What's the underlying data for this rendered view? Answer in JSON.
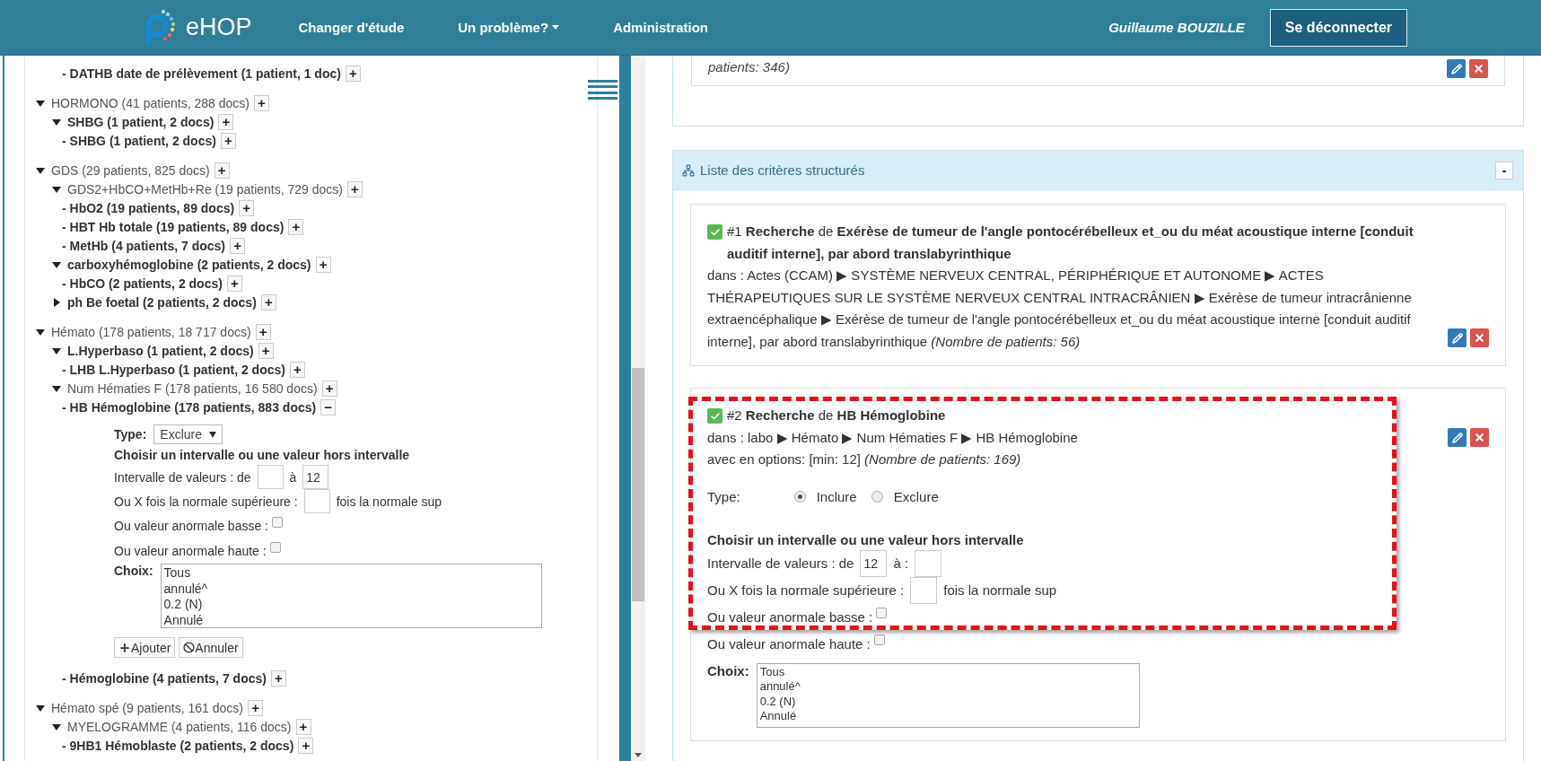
{
  "header": {
    "logo_text": "eHOP",
    "nav": [
      {
        "label": "Changer d'étude",
        "dropdown": false
      },
      {
        "label": "Un problème?",
        "dropdown": true
      },
      {
        "label": "Administration",
        "dropdown": false
      }
    ],
    "user": "Guillaume BOUZILLE",
    "logout": "Se déconnecter"
  },
  "tree": [
    {
      "children": [
        {
          "children": [
            {
              "label": "- DATHB date de prélèvement (1 patient, 1 doc)",
              "bold": true,
              "action": "+"
            }
          ]
        }
      ]
    },
    {
      "label": "HORMONO (41 patients, 288 docs)",
      "bold": false,
      "expanded": true,
      "action": "+",
      "children": [
        {
          "label": "SHBG (1 patient, 2 docs)",
          "bold": true,
          "expanded": true,
          "action": "+",
          "children": [
            {
              "label": "- SHBG (1 patient, 2 docs)",
              "bold": true,
              "action": "+"
            }
          ]
        }
      ]
    },
    {
      "label": "GDS (29 patients, 825 docs)",
      "bold": false,
      "expanded": true,
      "action": "+",
      "children": [
        {
          "label": "GDS2+HbCO+MetHb+Re (19 patients, 729 docs)",
          "bold": false,
          "expanded": true,
          "action": "+",
          "children": [
            {
              "label": "- HbO2 (19 patients, 89 docs)",
              "bold": true,
              "action": "+"
            },
            {
              "label": "- HBT Hb totale (19 patients, 89 docs)",
              "bold": true,
              "action": "+"
            },
            {
              "label": "- MetHb (4 patients, 7 docs)",
              "bold": true,
              "action": "+"
            }
          ]
        },
        {
          "label": "carboxyhémoglobine (2 patients, 2 docs)",
          "bold": true,
          "expanded": true,
          "action": "+",
          "children": [
            {
              "label": "- HbCO (2 patients, 2 docs)",
              "bold": true,
              "action": "+"
            }
          ]
        },
        {
          "label": "ph Be foetal (2 patients, 2 docs)",
          "bold": true,
          "expanded": false,
          "action": "+"
        }
      ]
    },
    {
      "label": "Hémato (178 patients, 18 717 docs)",
      "bold": false,
      "expanded": true,
      "action": "+",
      "children": [
        {
          "label": "L.Hyperbaso (1 patient, 2 docs)",
          "bold": true,
          "expanded": true,
          "action": "+",
          "children": [
            {
              "label": "- LHB L.Hyperbaso (1 patient, 2 docs)",
              "bold": true,
              "action": "+"
            }
          ]
        },
        {
          "label": "Num Hématies F (178 patients, 16 580 docs)",
          "bold": false,
          "expanded": true,
          "action": "+",
          "children": [
            {
              "label": "- HB Hémoglobine (178 patients, 883 docs)",
              "bold": true,
              "action": "−",
              "form": {
                "type_label": "Type:",
                "type_control": {
                  "kind": "select",
                  "value": "Exclure"
                },
                "heading": "Choisir un intervalle ou une valeur hors intervalle",
                "range": {
                  "label": "Intervalle de valeurs : de",
                  "separator": "à",
                  "max": "12"
                },
                "factor": {
                  "label": "Ou X fois la normale supérieure :",
                  "suffix": "fois la normale sup"
                },
                "flags": [
                  {
                    "label": "Ou valeur anormale basse :",
                    "checked": false
                  },
                  {
                    "label": "Ou valeur anormale haute :",
                    "checked": false
                  }
                ],
                "choice": {
                  "label": "Choix:",
                  "options": [
                    "Tous",
                    "annulé^",
                    "0.2 (N)",
                    "Annulé"
                  ]
                },
                "buttons": [
                  {
                    "label": "Ajouter",
                    "kind": "add"
                  },
                  {
                    "label": "Annuler",
                    "kind": "cancel"
                  }
                ]
              }
            },
            {
              "label": "- Hémoglobine (4 patients, 7 docs)",
              "bold": true,
              "action": "+"
            }
          ]
        }
      ]
    },
    {
      "label": "Hémato spé (9 patients, 161 docs)",
      "bold": false,
      "expanded": true,
      "action": "+",
      "children": [
        {
          "label": "MYELOGRAMME (4 patients, 116 docs)",
          "bold": false,
          "expanded": true,
          "action": "+",
          "children": [
            {
              "label": "- 9HB1 Hémoblaste (2 patients, 2 docs)",
              "bold": true,
              "action": "+"
            }
          ]
        }
      ]
    }
  ],
  "previous_card": {
    "count": "patients: 346)"
  },
  "criteria_panel": {
    "title": "Liste des critères structurés",
    "toggle": "-",
    "criteria": [
      {
        "heading": "#1 **Recherche** de **Exérèse de tumeur de l'angle pontocérébelleux et_ou du méat acoustique interne [conduit auditif interne], par abord translabyrinthique**",
        "path": "dans : Actes (CCAM) ▶ SYSTÈME NERVEUX CENTRAL, PÉRIPHÉRIQUE ET AUTONOME ▶ ACTES THÉRAPEUTIQUES SUR LE SYSTÈME NERVEUX CENTRAL INTRACRÂNIEN ▶ Exérèse de tumeur intracrânienne extraencéphalique ▶ Exérèse de tumeur de l'angle pontocérébelleux et_ou du méat acoustique interne [conduit auditif interne], par abord translabyrinthique *(Nombre de patients: 56)*",
        "highlighted": false
      },
      {
        "heading": "#2 **Recherche** de **HB Hémoglobine**",
        "path": "dans : labo ▶ Hémato ▶ Num Hématies F ▶ HB Hémoglobine",
        "options": "avec en options: [min: 12] *(Nombre de patients: 169)*",
        "highlighted": true,
        "form": {
          "type_label": "Type:",
          "type_control": {
            "kind": "radio",
            "options": [
              {
                "label": "Inclure",
                "selected": true
              },
              {
                "label": "Exclure",
                "selected": false
              }
            ]
          },
          "heading": "Choisir un intervalle ou une valeur hors intervalle",
          "range": {
            "label": "Intervalle de valeurs : de",
            "min": "12",
            "separator": "à :"
          },
          "factor": {
            "label": "Ou X fois la normale supérieure :",
            "suffix": "fois la normale sup"
          },
          "flags": [
            {
              "label": "Ou valeur anormale basse :",
              "checked": false
            },
            {
              "label": "Ou valeur anormale haute :",
              "checked": false
            }
          ],
          "choice": {
            "label": "Choix:",
            "options": [
              "Tous",
              "annulé^",
              "0.2 (N)",
              "Annulé"
            ]
          }
        }
      }
    ]
  }
}
